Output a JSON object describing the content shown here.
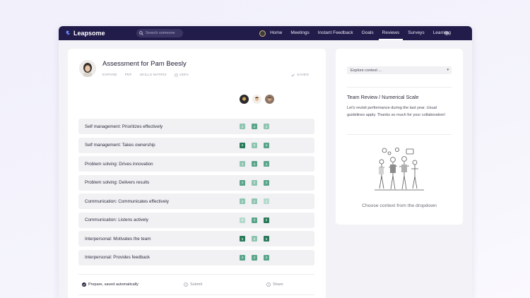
{
  "app": {
    "brand": "Leapsome"
  },
  "search": {
    "placeholder": "Search someone"
  },
  "nav": {
    "items": [
      {
        "label": "Home",
        "active": false
      },
      {
        "label": "Meetings",
        "active": false
      },
      {
        "label": "Instant Feedback",
        "active": false
      },
      {
        "label": "Goals",
        "active": false
      },
      {
        "label": "Reviews",
        "active": true
      },
      {
        "label": "Surveys",
        "active": false
      },
      {
        "label": "Learning",
        "active": false
      }
    ],
    "settings_icon": "gear-icon"
  },
  "assessment": {
    "title": "Assessment for Pam Beesly",
    "tools": {
      "expand": "EXPAND",
      "pdf": "PDF",
      "skills_matrix": "SKILLS MATRIX",
      "zoom": "100%"
    },
    "saved": "SAVED"
  },
  "rows": [
    {
      "label": "Self management: Prioritizes effectively",
      "scores": [
        "3",
        "4",
        "3"
      ]
    },
    {
      "label": "Self management: Takes ownership",
      "scores": [
        "5",
        "3",
        "4"
      ]
    },
    {
      "label": "Problem solving: Drives innovation",
      "scores": [
        "3",
        "4",
        "4"
      ]
    },
    {
      "label": "Problem solving: Delivers results",
      "scores": [
        "4",
        "3",
        "4"
      ]
    },
    {
      "label": "Communication: Communicates effectively",
      "scores": [
        "3",
        "3",
        "2"
      ]
    },
    {
      "label": "Communication: Listens actively",
      "scores": [
        "2",
        "4",
        "5"
      ]
    },
    {
      "label": "Interpersonal: Motivates the team",
      "scores": [
        "5",
        "3",
        "5"
      ]
    },
    {
      "label": "Interpersonal: Provides feedback",
      "scores": [
        "4",
        "4",
        "4"
      ]
    }
  ],
  "footer": {
    "prepare": "Prepare, saved automatically",
    "submit": "Submit",
    "share": "Share"
  },
  "sidebar": {
    "context_placeholder": "Explore context ...",
    "title": "Team Review / Numerical Scale",
    "text": "Let's revisit performance during the last year. Usual guidelines apply. Thanks so much for your collaboration!",
    "empty": "Choose context from the dropdown"
  },
  "colors": {
    "topbar": "#221c4a",
    "score_5": "#2a7a5a",
    "score_4": "#5aa58a",
    "score_3": "#8fc4b1",
    "score_2": "#b6d9cd"
  }
}
